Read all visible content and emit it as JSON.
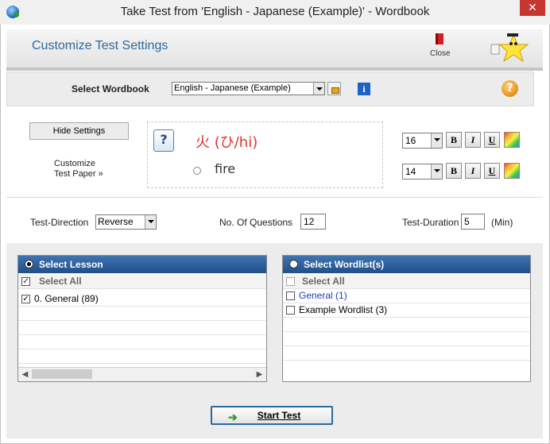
{
  "window": {
    "title": "Take Test from 'English - Japanese  (Example)' - Wordbook",
    "close_glyph": "✕"
  },
  "header": {
    "title": "Customize Test Settings",
    "close_label": "Close"
  },
  "wordbook": {
    "label": "Select Wordbook",
    "selected": "English - Japanese  (Example)"
  },
  "settings": {
    "hide_button": "Hide Settings",
    "customize_line1": "Customize",
    "customize_line2": "Test Paper  »",
    "preview_question": "火 (ひ/hi)",
    "preview_answer": "fire",
    "question_font_size": "16",
    "answer_font_size": "14",
    "bold": "B",
    "italic": "I",
    "underline": "U"
  },
  "params": {
    "direction_label": "Test-Direction",
    "direction_value": "Reverse",
    "questions_label": "No. Of Questions",
    "questions_value": "12",
    "duration_label": "Test-Duration",
    "duration_value": "5",
    "duration_unit": "(Min)"
  },
  "lesson_panel": {
    "title": "Select Lesson",
    "select_all": "Select All",
    "items": [
      {
        "label": "0. General (89)",
        "checked": true
      }
    ]
  },
  "wordlist_panel": {
    "title": "Select Wordlist(s)",
    "select_all": "Select All",
    "items": [
      {
        "label": "General (1)"
      },
      {
        "label": "Example Wordlist (3)"
      }
    ]
  },
  "start_button": "Start Test",
  "colors": {
    "accent": "#2b6aa0",
    "panel_header": "#1f4f8c",
    "question_text": "#e0332a"
  }
}
